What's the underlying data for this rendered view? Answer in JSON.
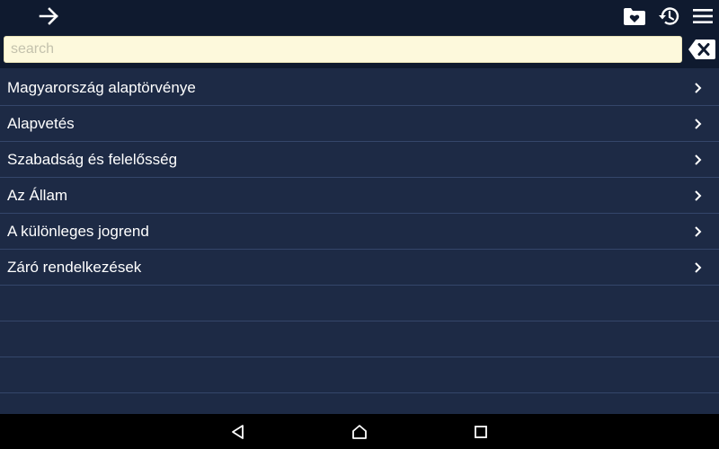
{
  "colors": {
    "app_bar": "#0f1a2f",
    "background": "#1d2a45",
    "divider": "#34466a",
    "search_bg": "#fdf9dc",
    "nav_bar": "#000000"
  },
  "app_bar": {
    "forward_icon": "arrow-right-icon",
    "actions": [
      "favorites-folder-icon",
      "history-icon",
      "menu-icon"
    ]
  },
  "search": {
    "placeholder": "search",
    "value": "",
    "clear_icon": "backspace-clear-icon"
  },
  "items": [
    {
      "label": "Magyarország alaptörvénye"
    },
    {
      "label": "Alapvetés"
    },
    {
      "label": "Szabadság és felelősség"
    },
    {
      "label": "Az Állam"
    },
    {
      "label": "A különleges jogrend"
    },
    {
      "label": "Záró rendelkezések"
    }
  ],
  "nav_bar": [
    "back-triangle-icon",
    "home-icon",
    "recents-square-icon"
  ]
}
